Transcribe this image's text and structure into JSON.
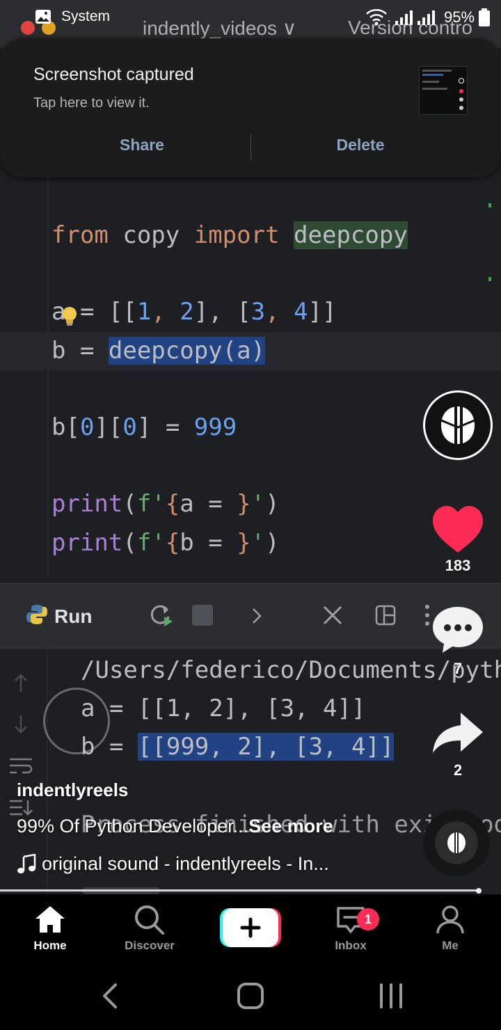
{
  "status_bar": {
    "app": "System",
    "battery": "95%"
  },
  "video": {
    "ide": {
      "project": "indently_videos ∨",
      "vcs": "Version contro",
      "code": {
        "l1_kw1": "from",
        "l1_mod": " copy ",
        "l1_kw2": "import",
        "l1_name": "deepcopy",
        "l2_a": "a",
        "l2_rest": "= [[",
        "l2_n1": "1",
        "l2_c1": ", ",
        "l2_n2": "2",
        "l2_m1": "], [",
        "l2_n3": "3",
        "l2_c2": ", ",
        "l2_n4": "4",
        "l2_end": "]]",
        "l3_lhs": "b = ",
        "l3_call": "deepcopy(a)",
        "l4_b": "b[",
        "l4_i1": "0",
        "l4_m": "][",
        "l4_i2": "0",
        "l4_e": "] = ",
        "l4_val": "999",
        "l5_fn": "print",
        "l5_open": "(",
        "l5_str": "f'",
        "l5_br": "{",
        "l5_var": "a = ",
        "l5_br2": "}",
        "l5_q": "'",
        "l5_close": ")",
        "l6_fn": "print",
        "l6_open": "(",
        "l6_str": "f'",
        "l6_br": "{",
        "l6_var": "b = ",
        "l6_br2": "}",
        "l6_q": "'",
        "l6_close": ")"
      },
      "run_label": "Run",
      "console": {
        "path": "/Users/federico/Documents/pythe",
        "line_a_var": "a",
        "line_a_val": " = [[1, 2], [3, 4]]",
        "line_b_var": "b",
        "line_b_eq": " = ",
        "line_b_val": "[[999, 2], [3, 4]]",
        "exit": "Process finished with exit cod"
      }
    }
  },
  "notification": {
    "title": "Screenshot captured",
    "text": "Tap here to view it.",
    "share": "Share",
    "delete": "Delete"
  },
  "actions": {
    "likes": "183",
    "comments": "7",
    "shares": "2",
    "like_color": "#fe2c55"
  },
  "caption": {
    "username": "indentlyreels",
    "description": "99% Of Python Developer...",
    "see_more": "See more",
    "sound": "original sound - indentlyreels - In..."
  },
  "nav": {
    "home": "Home",
    "discover": "Discover",
    "inbox": "Inbox",
    "inbox_badge": "1",
    "me": "Me"
  }
}
